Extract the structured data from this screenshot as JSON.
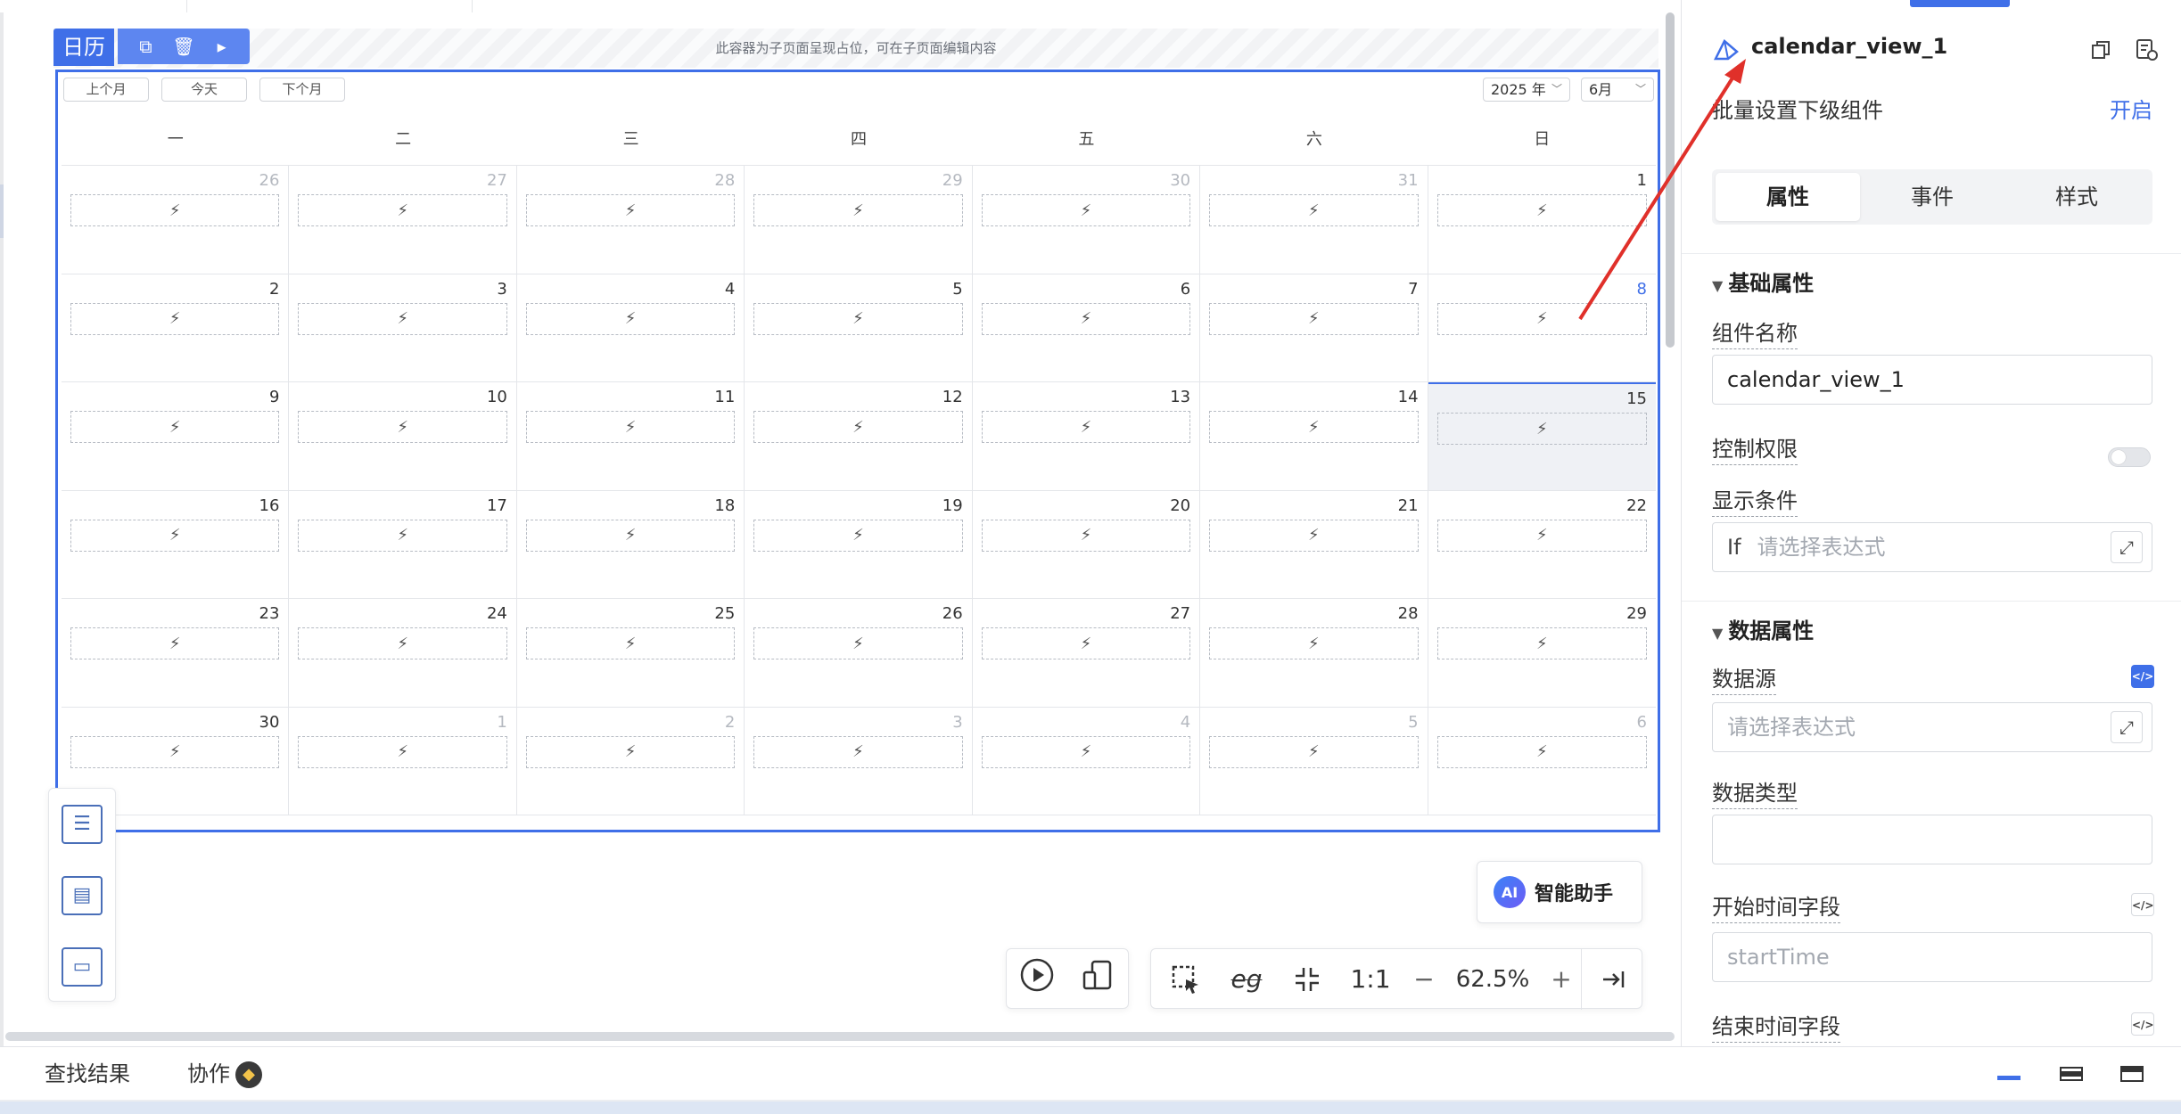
{
  "colors": {
    "accent": "#3f6fe8",
    "annotation_arrow": "#e0302a"
  },
  "component": {
    "tag_label": "日历",
    "placeholder_hint": "此容器为子页面呈现占位，可在子页面编辑内容",
    "actions": [
      {
        "icon": "copy-add-icon",
        "glyph": "⧉"
      },
      {
        "icon": "trash-icon",
        "glyph": "🗑"
      },
      {
        "icon": "play-arrow-icon",
        "glyph": "▸"
      }
    ]
  },
  "calendar": {
    "prev_month": "上个月",
    "today": "今天",
    "next_month": "下个月",
    "year_select": "2025 年",
    "month_select": "6月",
    "weekdays": [
      "一",
      "二",
      "三",
      "四",
      "五",
      "六",
      "日"
    ],
    "slot_icon": "lightning-icon",
    "slot_glyph": "⚡",
    "days": [
      {
        "n": "26",
        "other": true
      },
      {
        "n": "27",
        "other": true
      },
      {
        "n": "28",
        "other": true
      },
      {
        "n": "29",
        "other": true
      },
      {
        "n": "30",
        "other": true
      },
      {
        "n": "31",
        "other": true
      },
      {
        "n": "1"
      },
      {
        "n": "2"
      },
      {
        "n": "3"
      },
      {
        "n": "4"
      },
      {
        "n": "5"
      },
      {
        "n": "6"
      },
      {
        "n": "7"
      },
      {
        "n": "8",
        "highlight": true
      },
      {
        "n": "9"
      },
      {
        "n": "10"
      },
      {
        "n": "11"
      },
      {
        "n": "12"
      },
      {
        "n": "13"
      },
      {
        "n": "14"
      },
      {
        "n": "15",
        "today": true
      },
      {
        "n": "16"
      },
      {
        "n": "17"
      },
      {
        "n": "18"
      },
      {
        "n": "19"
      },
      {
        "n": "20"
      },
      {
        "n": "21"
      },
      {
        "n": "22"
      },
      {
        "n": "23"
      },
      {
        "n": "24"
      },
      {
        "n": "25"
      },
      {
        "n": "26"
      },
      {
        "n": "27"
      },
      {
        "n": "28"
      },
      {
        "n": "29"
      },
      {
        "n": "30"
      },
      {
        "n": "1",
        "other": true
      },
      {
        "n": "2",
        "other": true
      },
      {
        "n": "3",
        "other": true
      },
      {
        "n": "4",
        "other": true
      },
      {
        "n": "5",
        "other": true
      },
      {
        "n": "6",
        "other": true
      }
    ]
  },
  "float_panel": [
    {
      "icon": "outline-panel-icon",
      "glyph": "☰"
    },
    {
      "icon": "page-structure-icon",
      "glyph": "▤"
    },
    {
      "icon": "component-box-icon",
      "glyph": "▭"
    }
  ],
  "ai_assistant": {
    "badge": "AI",
    "label": "智能助手"
  },
  "bottom_toolbar": {
    "play_icon": "play-circle-icon",
    "device_icon": "device-icon",
    "select_icon": "box-select-icon",
    "eg_label": "eg",
    "shrink_icon": "shrink-icon",
    "ratio_label": "1:1",
    "zoom_out": "−",
    "zoom": "62.5%",
    "zoom_in": "+",
    "collapse_icon": "collapse-right-icon"
  },
  "statusbar": {
    "search_results": "查找结果",
    "collab": "协作"
  },
  "right_panel": {
    "title": "calendar_view_1",
    "batch_label": "批量设置下级组件",
    "batch_toggle": "开启",
    "tabs": [
      "属性",
      "事件",
      "样式"
    ],
    "section_basic": "基础属性",
    "name_label": "组件名称",
    "name_value": "calendar_view_1",
    "permission_label": "控制权限",
    "display_label": "显示条件",
    "if_prefix": "If",
    "expr_placeholder": "请选择表达式",
    "section_data": "数据属性",
    "datasource_label": "数据源",
    "datatype_label": "数据类型",
    "start_field_label": "开始时间字段",
    "start_field_placeholder": "startTime",
    "end_field_label": "结束时间字段"
  }
}
